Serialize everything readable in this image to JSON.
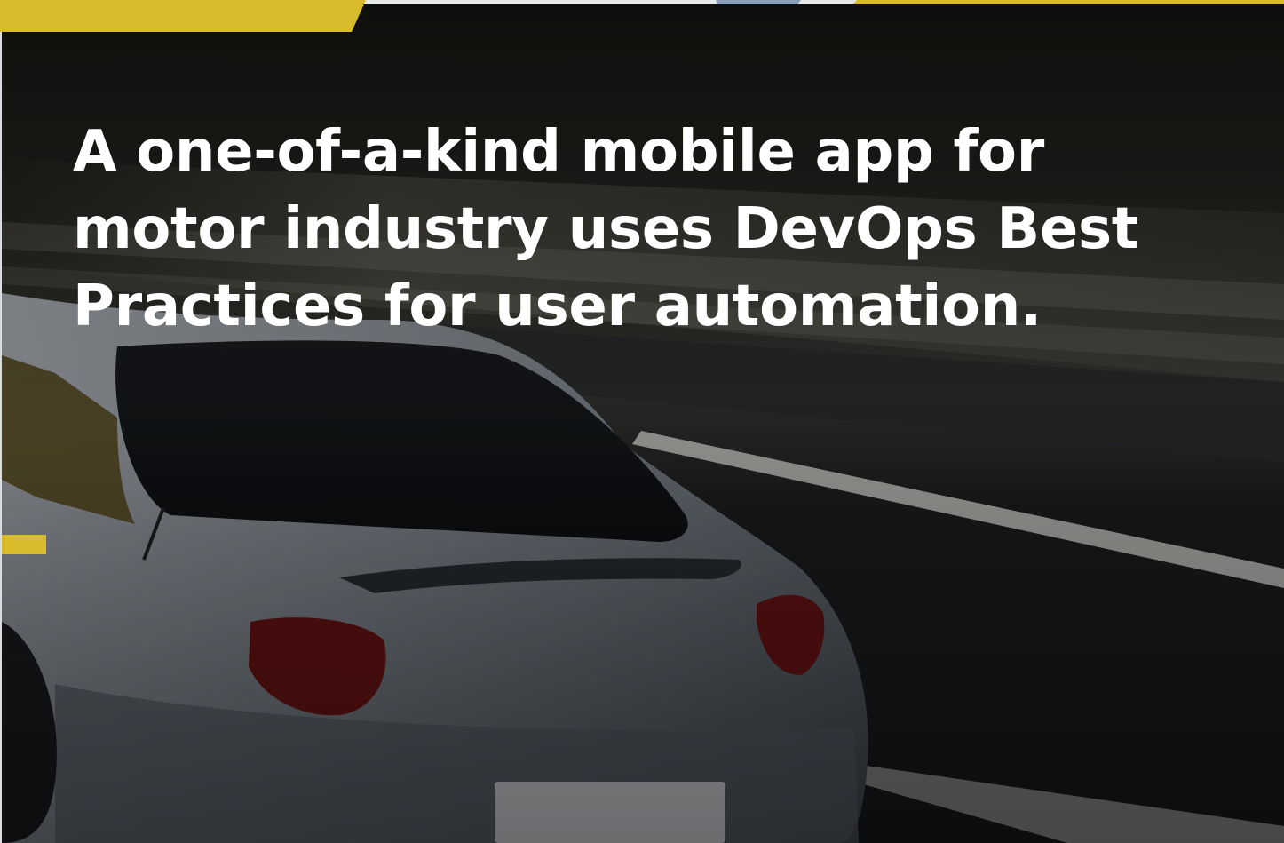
{
  "headline": {
    "line1": "A one-of-a-kind mobile app for",
    "line2": "motor industry uses DevOps Best",
    "line3": "Practices for user automation."
  },
  "colors": {
    "accent_yellow": "#d8bc2c",
    "accent_blue": "#8aa0b8",
    "text": "#ffffff",
    "overlay": "#141414"
  },
  "image": {
    "subject": "car-on-highway-photo"
  }
}
